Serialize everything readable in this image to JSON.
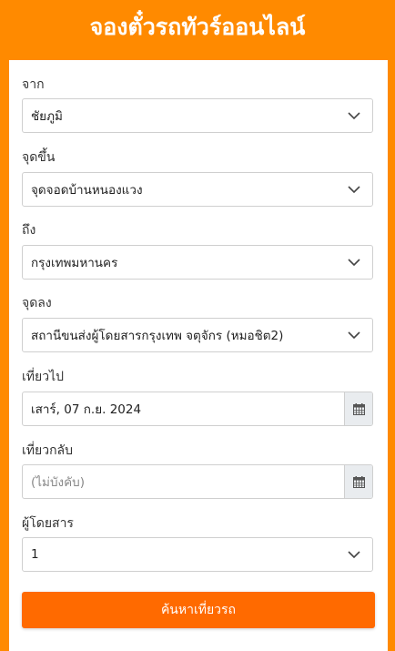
{
  "header": {
    "title": "จองตั๋วรถทัวร์ออนไลน์"
  },
  "form": {
    "from": {
      "label": "จาก",
      "value": "ชัยภูมิ"
    },
    "pickup": {
      "label": "จุดขึ้น",
      "value": "จุดจอดบ้านหนองแวง"
    },
    "to": {
      "label": "ถึง",
      "value": "กรุงเทพมหานคร"
    },
    "dropoff": {
      "label": "จุดลง",
      "value": "สถานีขนส่งผู้โดยสารกรุงเทพ จตุจักร (หมอชิต2)"
    },
    "departure": {
      "label": "เที่ยวไป",
      "value": "เสาร์, 07 ก.ย. 2024"
    },
    "return": {
      "label": "เที่ยวกลับ",
      "placeholder": "(ไม่บังคับ)"
    },
    "passengers": {
      "label": "ผู้โดยสาร",
      "value": "1"
    },
    "submit_label": "ค้นหาเที่ยวรถ"
  },
  "icons": {
    "dropdown": "chevron-down-icon",
    "calendar": "calendar-icon"
  },
  "colors": {
    "background": "#ff8a00",
    "button": "#ff6a00",
    "calendar_button_bg": "#e9ecef"
  }
}
